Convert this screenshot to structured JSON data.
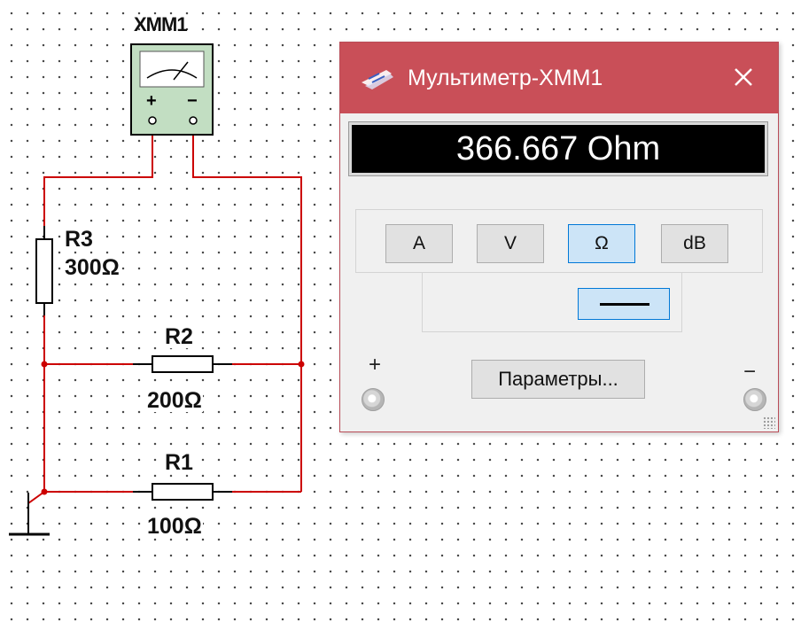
{
  "schematic": {
    "instrument_ref": "XMM1",
    "meter_plus": "+",
    "meter_minus": "−",
    "resistors": [
      {
        "ref": "R3",
        "value": "300Ω"
      },
      {
        "ref": "R2",
        "value": "200Ω"
      },
      {
        "ref": "R1",
        "value": "100Ω"
      }
    ],
    "wire_color": "#cc0000"
  },
  "window": {
    "title": "Мультиметр-XMM1",
    "close_glyph": "✕",
    "titlebar_color": "#c94f58",
    "display": "366.667 Ohm",
    "modes": [
      "A",
      "V",
      "Ω",
      "dB"
    ],
    "active_mode": "Ω",
    "signal_mode": "DC",
    "params_button": "Параметры...",
    "terminal_plus": "+",
    "terminal_minus": "−"
  }
}
